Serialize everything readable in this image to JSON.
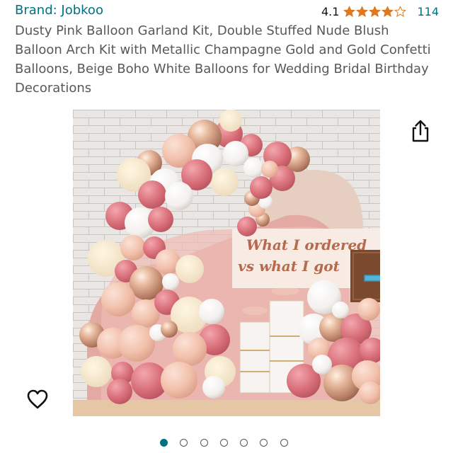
{
  "product": {
    "brand": "Brand: Jobkoo",
    "rating_value": "4.1",
    "rating_fraction": 0.82,
    "review_count": "114",
    "title": "Dusty Pink Balloon Garland Kit, Double Stuffed Nude Blush Balloon Arch Kit with Metallic Champagne Gold and Gold Confetti Balloons, Beige Boho White Balloons for Wedding Bridal Birthday Decorations"
  },
  "image_overlay": {
    "caption_line1": "What I ordered",
    "caption_line2": "vs what I got"
  },
  "gallery": {
    "total_images": 7,
    "active_index": 0
  },
  "icons": {
    "share": "share-icon",
    "favorite": "heart-icon",
    "star": "star-icon"
  },
  "colors": {
    "link": "#007185",
    "star": "#de7921",
    "title": "#565959",
    "dot_active": "#007185"
  }
}
